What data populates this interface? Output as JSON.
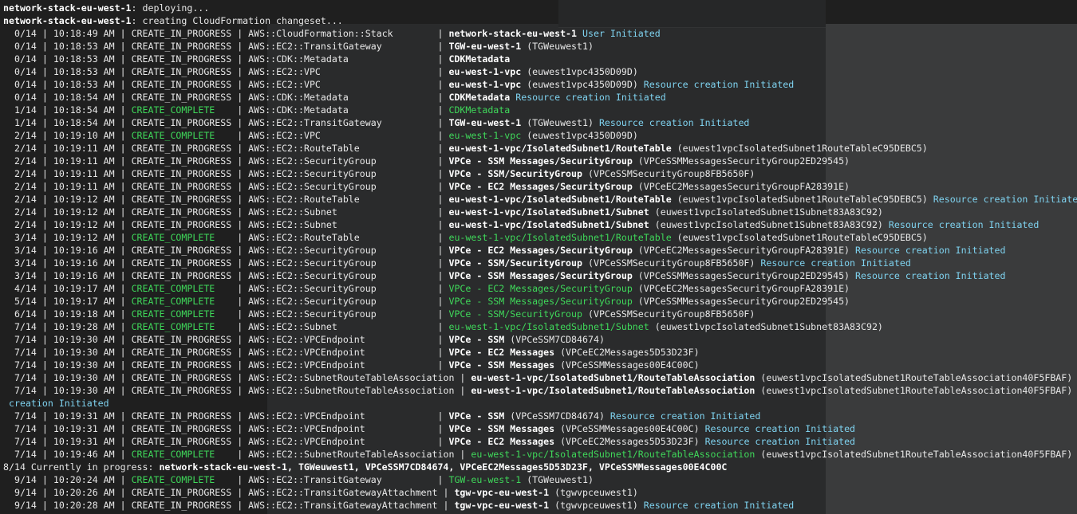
{
  "header_lines": [
    {
      "stack": "network-stack-eu-west-1",
      "text": ": deploying..."
    },
    {
      "stack": "network-stack-eu-west-1",
      "text": ": creating CloudFormation changeset..."
    }
  ],
  "events": [
    {
      "p": "0/14",
      "t": "10:18:49 AM",
      "s": "CREATE_IN_PROGRESS",
      "ty": "AWS::CloudFormation::Stack",
      "r": "network-stack-eu-west-1",
      "ph": "",
      "n": "User Initiated"
    },
    {
      "p": "0/14",
      "t": "10:18:53 AM",
      "s": "CREATE_IN_PROGRESS",
      "ty": "AWS::EC2::TransitGateway",
      "r": "TGW-eu-west-1",
      "ph": "(TGWeuwest1)",
      "n": ""
    },
    {
      "p": "0/14",
      "t": "10:18:53 AM",
      "s": "CREATE_IN_PROGRESS",
      "ty": "AWS::CDK::Metadata",
      "r": "CDKMetadata",
      "ph": "",
      "n": ""
    },
    {
      "p": "0/14",
      "t": "10:18:53 AM",
      "s": "CREATE_IN_PROGRESS",
      "ty": "AWS::EC2::VPC",
      "r": "eu-west-1-vpc",
      "ph": "(euwest1vpc4350D09D)",
      "n": ""
    },
    {
      "p": "0/14",
      "t": "10:18:53 AM",
      "s": "CREATE_IN_PROGRESS",
      "ty": "AWS::EC2::VPC",
      "r": "eu-west-1-vpc",
      "ph": "(euwest1vpc4350D09D)",
      "n": "Resource creation Initiated"
    },
    {
      "p": "0/14",
      "t": "10:18:54 AM",
      "s": "CREATE_IN_PROGRESS",
      "ty": "AWS::CDK::Metadata",
      "r": "CDKMetadata",
      "ph": "",
      "n": "Resource creation Initiated"
    },
    {
      "p": "1/14",
      "t": "10:18:54 AM",
      "s": "CREATE_COMPLETE",
      "ty": "AWS::CDK::Metadata",
      "r": "CDKMetadata",
      "ph": "",
      "n": ""
    },
    {
      "p": "1/14",
      "t": "10:18:54 AM",
      "s": "CREATE_IN_PROGRESS",
      "ty": "AWS::EC2::TransitGateway",
      "r": "TGW-eu-west-1",
      "ph": "(TGWeuwest1)",
      "n": "Resource creation Initiated"
    },
    {
      "p": "2/14",
      "t": "10:19:10 AM",
      "s": "CREATE_COMPLETE",
      "ty": "AWS::EC2::VPC",
      "r": "eu-west-1-vpc",
      "ph": "(euwest1vpc4350D09D)",
      "n": ""
    },
    {
      "p": "2/14",
      "t": "10:19:11 AM",
      "s": "CREATE_IN_PROGRESS",
      "ty": "AWS::EC2::RouteTable",
      "r": "eu-west-1-vpc/IsolatedSubnet1/RouteTable",
      "ph": "(euwest1vpcIsolatedSubnet1RouteTableC95DEBC5)",
      "n": ""
    },
    {
      "p": "2/14",
      "t": "10:19:11 AM",
      "s": "CREATE_IN_PROGRESS",
      "ty": "AWS::EC2::SecurityGroup",
      "r": "VPCe - SSM Messages/SecurityGroup",
      "ph": "(VPCeSSMMessagesSecurityGroup2ED29545)",
      "n": ""
    },
    {
      "p": "2/14",
      "t": "10:19:11 AM",
      "s": "CREATE_IN_PROGRESS",
      "ty": "AWS::EC2::SecurityGroup",
      "r": "VPCe - SSM/SecurityGroup",
      "ph": "(VPCeSSMSecurityGroup8FB5650F)",
      "n": ""
    },
    {
      "p": "2/14",
      "t": "10:19:11 AM",
      "s": "CREATE_IN_PROGRESS",
      "ty": "AWS::EC2::SecurityGroup",
      "r": "VPCe - EC2 Messages/SecurityGroup",
      "ph": "(VPCeEC2MessagesSecurityGroupFA28391E)",
      "n": ""
    },
    {
      "p": "2/14",
      "t": "10:19:12 AM",
      "s": "CREATE_IN_PROGRESS",
      "ty": "AWS::EC2::RouteTable",
      "r": "eu-west-1-vpc/IsolatedSubnet1/RouteTable",
      "ph": "(euwest1vpcIsolatedSubnet1RouteTableC95DEBC5)",
      "n": "Resource creation Initiated"
    },
    {
      "p": "2/14",
      "t": "10:19:12 AM",
      "s": "CREATE_IN_PROGRESS",
      "ty": "AWS::EC2::Subnet",
      "r": "eu-west-1-vpc/IsolatedSubnet1/Subnet",
      "ph": "(euwest1vpcIsolatedSubnet1Subnet83A83C92)",
      "n": ""
    },
    {
      "p": "2/14",
      "t": "10:19:12 AM",
      "s": "CREATE_IN_PROGRESS",
      "ty": "AWS::EC2::Subnet",
      "r": "eu-west-1-vpc/IsolatedSubnet1/Subnet",
      "ph": "(euwest1vpcIsolatedSubnet1Subnet83A83C92)",
      "n": "Resource creation Initiated"
    },
    {
      "p": "3/14",
      "t": "10:19:12 AM",
      "s": "CREATE_COMPLETE",
      "ty": "AWS::EC2::RouteTable",
      "r": "eu-west-1-vpc/IsolatedSubnet1/RouteTable",
      "ph": "(euwest1vpcIsolatedSubnet1RouteTableC95DEBC5)",
      "n": ""
    },
    {
      "p": "3/14",
      "t": "10:19:16 AM",
      "s": "CREATE_IN_PROGRESS",
      "ty": "AWS::EC2::SecurityGroup",
      "r": "VPCe - EC2 Messages/SecurityGroup",
      "ph": "(VPCeEC2MessagesSecurityGroupFA28391E)",
      "n": "Resource creation Initiated"
    },
    {
      "p": "3/14",
      "t": "10:19:16 AM",
      "s": "CREATE_IN_PROGRESS",
      "ty": "AWS::EC2::SecurityGroup",
      "r": "VPCe - SSM/SecurityGroup",
      "ph": "(VPCeSSMSecurityGroup8FB5650F)",
      "n": "Resource creation Initiated"
    },
    {
      "p": "3/14",
      "t": "10:19:16 AM",
      "s": "CREATE_IN_PROGRESS",
      "ty": "AWS::EC2::SecurityGroup",
      "r": "VPCe - SSM Messages/SecurityGroup",
      "ph": "(VPCeSSMMessagesSecurityGroup2ED29545)",
      "n": "Resource creation Initiated"
    },
    {
      "p": "4/14",
      "t": "10:19:17 AM",
      "s": "CREATE_COMPLETE",
      "ty": "AWS::EC2::SecurityGroup",
      "r": "VPCe - EC2 Messages/SecurityGroup",
      "ph": "(VPCeEC2MessagesSecurityGroupFA28391E)",
      "n": ""
    },
    {
      "p": "5/14",
      "t": "10:19:17 AM",
      "s": "CREATE_COMPLETE",
      "ty": "AWS::EC2::SecurityGroup",
      "r": "VPCe - SSM Messages/SecurityGroup",
      "ph": "(VPCeSSMMessagesSecurityGroup2ED29545)",
      "n": ""
    },
    {
      "p": "6/14",
      "t": "10:19:18 AM",
      "s": "CREATE_COMPLETE",
      "ty": "AWS::EC2::SecurityGroup",
      "r": "VPCe - SSM/SecurityGroup",
      "ph": "(VPCeSSMSecurityGroup8FB5650F)",
      "n": ""
    },
    {
      "p": "7/14",
      "t": "10:19:28 AM",
      "s": "CREATE_COMPLETE",
      "ty": "AWS::EC2::Subnet",
      "r": "eu-west-1-vpc/IsolatedSubnet1/Subnet",
      "ph": "(euwest1vpcIsolatedSubnet1Subnet83A83C92)",
      "n": ""
    },
    {
      "p": "7/14",
      "t": "10:19:30 AM",
      "s": "CREATE_IN_PROGRESS",
      "ty": "AWS::EC2::VPCEndpoint",
      "r": "VPCe - SSM",
      "ph": "(VPCeSSM7CD84674)",
      "n": ""
    },
    {
      "p": "7/14",
      "t": "10:19:30 AM",
      "s": "CREATE_IN_PROGRESS",
      "ty": "AWS::EC2::VPCEndpoint",
      "r": "VPCe - EC2 Messages",
      "ph": "(VPCeEC2Messages5D53D23F)",
      "n": ""
    },
    {
      "p": "7/14",
      "t": "10:19:30 AM",
      "s": "CREATE_IN_PROGRESS",
      "ty": "AWS::EC2::VPCEndpoint",
      "r": "VPCe - SSM Messages",
      "ph": "(VPCeSSMMessages00E4C00C)",
      "n": ""
    },
    {
      "p": "7/14",
      "t": "10:19:30 AM",
      "s": "CREATE_IN_PROGRESS",
      "ty": "AWS::EC2::SubnetRouteTableAssociation",
      "r": "eu-west-1-vpc/IsolatedSubnet1/RouteTableAssociation",
      "ph": "(euwest1vpcIsolatedSubnet1RouteTableAssociation40F5FBAF)",
      "n": ""
    },
    {
      "p": "7/14",
      "t": "10:19:30 AM",
      "s": "CREATE_IN_PROGRESS",
      "ty": "AWS::EC2::SubnetRouteTableAssociation",
      "r": "eu-west-1-vpc/IsolatedSubnet1/RouteTableAssociation",
      "ph": "(euwest1vpcIsolatedSubnet1RouteTableAssociation40F5FBAF)",
      "n": "Resource",
      "wrap": "creation Initiated"
    },
    {
      "p": "7/14",
      "t": "10:19:31 AM",
      "s": "CREATE_IN_PROGRESS",
      "ty": "AWS::EC2::VPCEndpoint",
      "r": "VPCe - SSM",
      "ph": "(VPCeSSM7CD84674)",
      "n": "Resource creation Initiated"
    },
    {
      "p": "7/14",
      "t": "10:19:31 AM",
      "s": "CREATE_IN_PROGRESS",
      "ty": "AWS::EC2::VPCEndpoint",
      "r": "VPCe - SSM Messages",
      "ph": "(VPCeSSMMessages00E4C00C)",
      "n": "Resource creation Initiated"
    },
    {
      "p": "7/14",
      "t": "10:19:31 AM",
      "s": "CREATE_IN_PROGRESS",
      "ty": "AWS::EC2::VPCEndpoint",
      "r": "VPCe - EC2 Messages",
      "ph": "(VPCeEC2Messages5D53D23F)",
      "n": "Resource creation Initiated"
    },
    {
      "p": "7/14",
      "t": "10:19:46 AM",
      "s": "CREATE_COMPLETE",
      "ty": "AWS::EC2::SubnetRouteTableAssociation",
      "r": "eu-west-1-vpc/IsolatedSubnet1/RouteTableAssociation",
      "ph": "(euwest1vpcIsolatedSubnet1RouteTableAssociation40F5FBAF)",
      "n": ""
    }
  ],
  "summary": {
    "prefix": "8/14 Currently in progress: ",
    "ids": "network-stack-eu-west-1, TGWeuwest1, VPCeSSM7CD84674, VPCeEC2Messages5D53D23F, VPCeSSMMessages00E4C00C"
  },
  "events_after": [
    {
      "p": "9/14",
      "t": "10:20:24 AM",
      "s": "CREATE_COMPLETE",
      "ty": "AWS::EC2::TransitGateway",
      "r": "TGW-eu-west-1",
      "ph": "(TGWeuwest1)",
      "n": ""
    },
    {
      "p": "9/14",
      "t": "10:20:26 AM",
      "s": "CREATE_IN_PROGRESS",
      "ty": "AWS::EC2::TransitGatewayAttachment",
      "r": "tgw-vpc-eu-west-1",
      "ph": "(tgwvpceuwest1)",
      "n": ""
    },
    {
      "p": "9/14",
      "t": "10:20:28 AM",
      "s": "CREATE_IN_PROGRESS",
      "ty": "AWS::EC2::TransitGatewayAttachment",
      "r": "tgw-vpc-eu-west-1",
      "ph": "(tgwvpceuwest1)",
      "n": "Resource creation Initiated"
    }
  ],
  "colors": {
    "background": "#1f1f1f",
    "text": "#e8e8e8",
    "complete_green": "#3fd85a",
    "note_cyan": "#7fd3f0"
  }
}
